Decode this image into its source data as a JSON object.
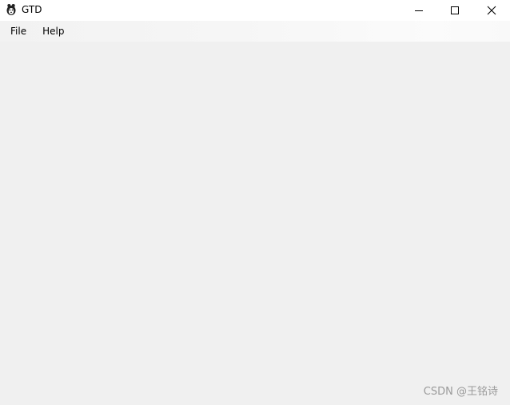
{
  "window": {
    "title": "GTD",
    "icon": "app-icon",
    "controls": {
      "minimize": "minimize-icon",
      "maximize": "maximize-icon",
      "close": "close-icon"
    }
  },
  "menu": {
    "items": [
      {
        "label": "File"
      },
      {
        "label": "Help"
      }
    ]
  },
  "watermark": "CSDN @王铭诗"
}
